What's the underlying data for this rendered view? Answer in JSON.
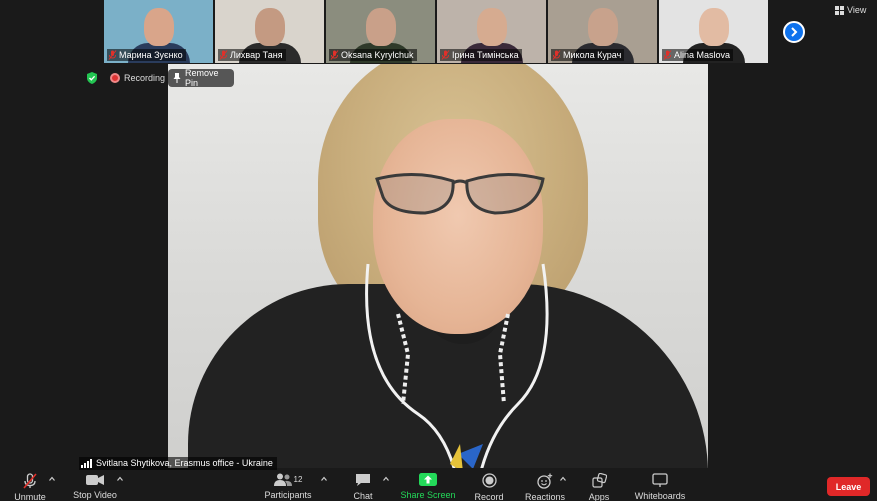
{
  "participants_strip": [
    {
      "name": "Марина Зуєнко",
      "face": "#d9a58a",
      "body": "#2a3c5c",
      "bg": "#7bb0c8"
    },
    {
      "name": "Лихвар Таня",
      "face": "#c49a82",
      "body": "#2b2b2b",
      "bg": "#d9d4cc"
    },
    {
      "name": "Oksana Kyrylchuk",
      "face": "#c9a089",
      "body": "#2f3a2a",
      "bg": "#8b8d7e"
    },
    {
      "name": "Ірина Тимінська",
      "face": "#d6ab90",
      "body": "#3a2a3a",
      "bg": "#bdb3aa"
    },
    {
      "name": "Микола Курач",
      "face": "#c8a28c",
      "body": "#2b2b30",
      "bg": "#a99f92"
    },
    {
      "name": "Alina Maslova",
      "face": "#e2bba3",
      "body": "#222222",
      "bg": "#e3e3e3"
    }
  ],
  "top_controls": {
    "view_label": "View",
    "next_icon": "chevron-right-icon"
  },
  "status": {
    "recording_label": "Recording",
    "remove_pin_label": "Remove Pin"
  },
  "speaker": {
    "name": "Svitlana Shytikova, Erasmus office - Ukraine"
  },
  "toolbar": {
    "unmute": "Unmute",
    "stop_video": "Stop Video",
    "participants": "Participants",
    "participants_count": "12",
    "chat": "Chat",
    "share_screen": "Share Screen",
    "record": "Record",
    "reactions": "Reactions",
    "apps": "Apps",
    "whiteboards": "Whiteboards",
    "leave": "Leave"
  },
  "colors": {
    "share_green": "#23d959",
    "leave_red": "#e02828",
    "accent_blue": "#0e72ed",
    "muted_red": "#e0302a"
  }
}
